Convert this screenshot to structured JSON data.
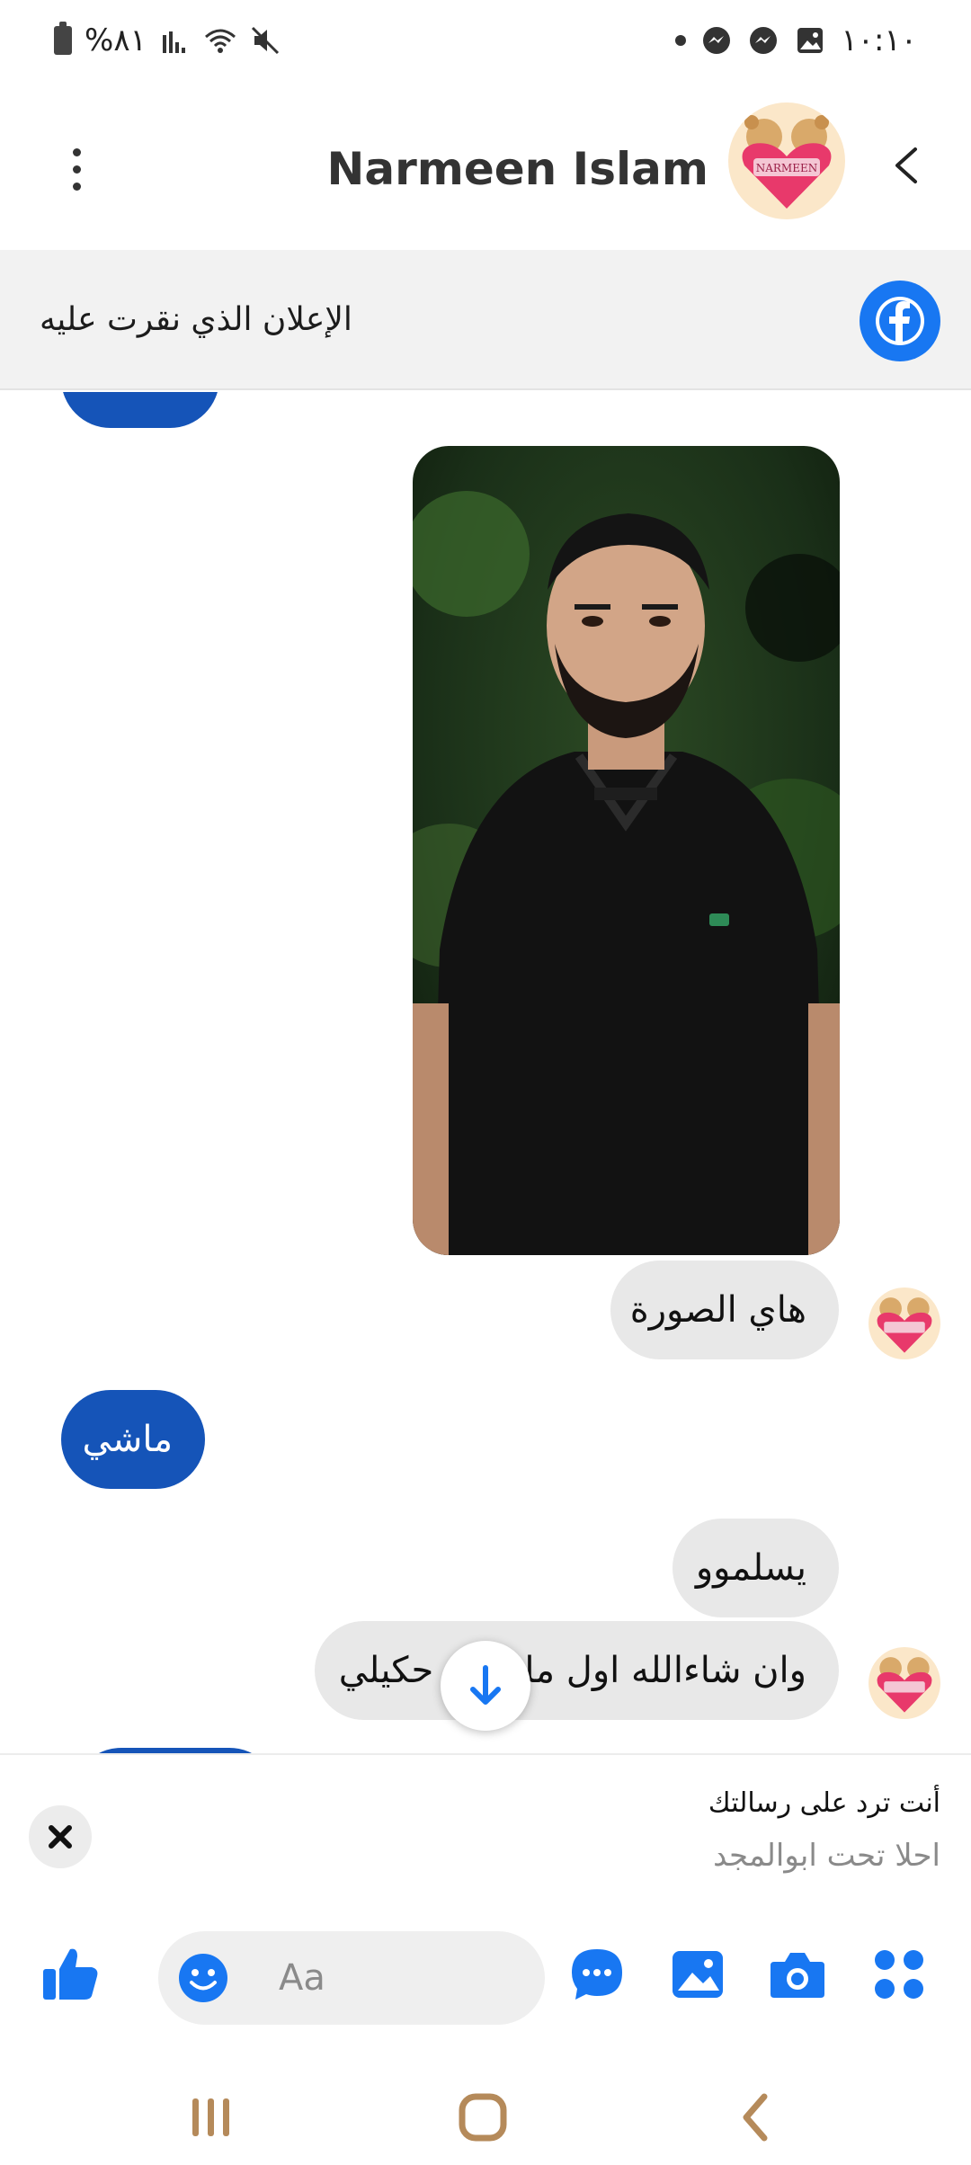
{
  "status_bar": {
    "time": "١٠:١٠",
    "battery_text": "%٨١",
    "icons_left": [
      "battery-icon",
      "signal-icon",
      "wifi-icon",
      "mute-icon"
    ],
    "icons_right": [
      "notification-dot-icon",
      "messenger-icon",
      "messenger-icon",
      "gallery-icon"
    ]
  },
  "header": {
    "contact_name": "Narmeen Islam",
    "avatar_label": "NARMEEN"
  },
  "ad_banner": {
    "text": "الإعلان الذي نقرت عليه"
  },
  "messages": [
    {
      "type": "image",
      "direction": "incoming",
      "alt": ""
    },
    {
      "type": "text",
      "direction": "incoming",
      "text": "هاي الصورة"
    },
    {
      "type": "text",
      "direction": "outgoing",
      "text": "ماشي"
    },
    {
      "type": "text",
      "direction": "incoming",
      "text": "يسلموو"
    },
    {
      "type": "text",
      "direction": "incoming",
      "text": "وان شاءالله اول ما ت... حكيلي"
    }
  ],
  "reply_panel": {
    "title": "أنت ترد على رسالتك",
    "quote": "احلا تحت ابوالمجد"
  },
  "composer": {
    "placeholder": "Aa"
  },
  "colors": {
    "messenger_blue": "#1877f2",
    "outgoing_bubble": "#1554b8",
    "incoming_bubble": "#e8e8e8"
  }
}
